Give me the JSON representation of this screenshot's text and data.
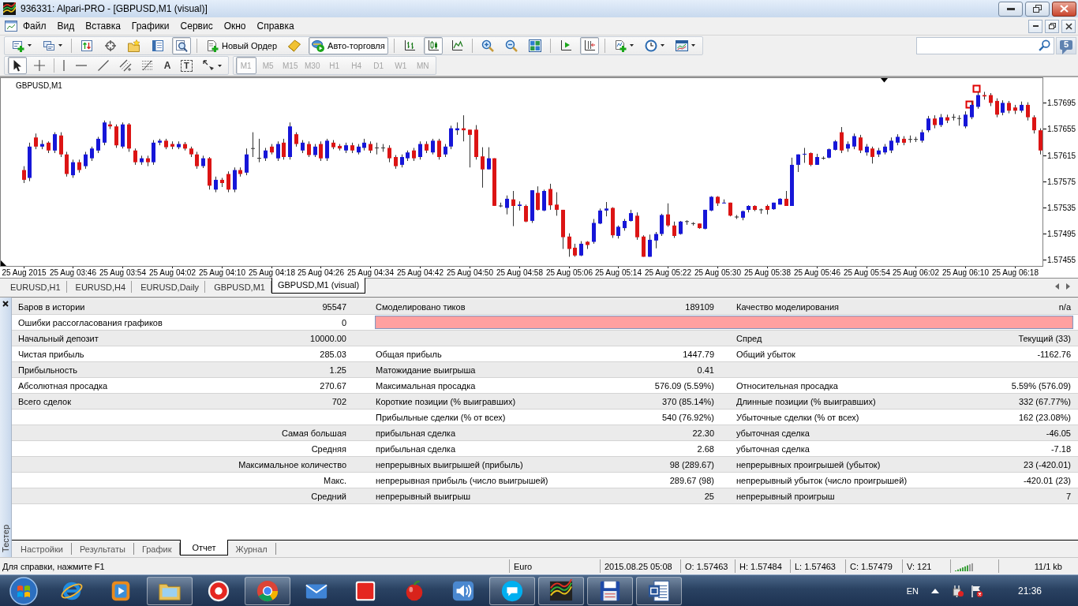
{
  "window": {
    "title": "936331: Alpari-PRO - [GBPUSD,M1 (visual)]"
  },
  "menu": [
    "Файл",
    "Вид",
    "Вставка",
    "Графики",
    "Сервис",
    "Окно",
    "Справка"
  ],
  "main_toolbar": [
    {
      "kind": "icon",
      "pressed": false
    },
    {
      "kind": "icon",
      "pressed": false
    },
    {
      "kind": "icon",
      "pressed": false
    },
    {
      "kind": "icon",
      "pressed": false
    },
    {
      "kind": "icon",
      "pressed": false
    },
    {
      "kind": "icon",
      "pressed": false
    },
    {
      "kind": "icon",
      "pressed": true
    },
    {
      "kind": "button",
      "label": "Новый Ордер",
      "pressed": false
    },
    {
      "kind": "icon",
      "pressed": false
    },
    {
      "kind": "button",
      "label": "Авто-торговля",
      "pressed": true
    },
    {
      "kind": "icon",
      "pressed": false
    },
    {
      "kind": "icon",
      "pressed": true
    },
    {
      "kind": "icon",
      "pressed": false
    },
    {
      "kind": "icon",
      "pressed": false
    },
    {
      "kind": "icon",
      "pressed": false
    },
    {
      "kind": "icon",
      "pressed": false
    },
    {
      "kind": "icon",
      "pressed": false
    },
    {
      "kind": "icon",
      "pressed": true
    },
    {
      "kind": "icon",
      "pressed": false
    },
    {
      "kind": "icon",
      "pressed": false
    },
    {
      "kind": "icon",
      "pressed": false
    }
  ],
  "notifications": {
    "count": "5"
  },
  "drawing_toolbar": [
    {
      "kind": "icon",
      "pressed": true
    },
    {
      "kind": "icon",
      "pressed": false
    },
    {
      "kind": "icon",
      "pressed": false
    },
    {
      "kind": "icon",
      "pressed": false
    },
    {
      "kind": "icon",
      "pressed": false
    },
    {
      "kind": "icon",
      "pressed": false
    },
    {
      "kind": "icon",
      "pressed": false
    },
    {
      "kind": "letter",
      "glyph": "A",
      "pressed": false
    },
    {
      "kind": "boxed_letter",
      "glyph": "T",
      "pressed": false
    },
    {
      "kind": "icon",
      "pressed": false
    }
  ],
  "periods": [
    {
      "label": "M1",
      "selected": true,
      "disabled": true
    },
    {
      "label": "M5",
      "selected": false,
      "disabled": true
    },
    {
      "label": "M15",
      "selected": false,
      "disabled": true
    },
    {
      "label": "M30",
      "selected": false,
      "disabled": true
    },
    {
      "label": "H1",
      "selected": false,
      "disabled": true
    },
    {
      "label": "H4",
      "selected": false,
      "disabled": true
    },
    {
      "label": "D1",
      "selected": false,
      "disabled": true
    },
    {
      "label": "W1",
      "selected": false,
      "disabled": true
    },
    {
      "label": "MN",
      "selected": false,
      "disabled": true
    }
  ],
  "chart": {
    "chart_data": [
      {
        "type": "candlestick",
        "title": "GBPUSD,M1",
        "ylim": [
          1.57445,
          1.57733
        ],
        "yticks": [
          1.57455,
          1.57495,
          1.57535,
          1.57575,
          1.57615,
          1.57655,
          1.57695
        ],
        "categories": [
          "25 Aug 2015",
          null,
          null,
          null,
          null,
          null,
          null,
          null,
          "25 Aug 03:46",
          null,
          null,
          null,
          null,
          null,
          null,
          null,
          "25 Aug 03:54",
          null,
          null,
          null,
          null,
          null,
          null,
          null,
          "25 Aug 04:02",
          null,
          null,
          null,
          null,
          null,
          null,
          null,
          "25 Aug 04:10",
          null,
          null,
          null,
          null,
          null,
          null,
          null,
          "25 Aug 04:18",
          null,
          null,
          null,
          null,
          null,
          null,
          null,
          "25 Aug 04:26",
          null,
          null,
          null,
          null,
          null,
          null,
          null,
          "25 Aug 04:34",
          null,
          null,
          null,
          null,
          null,
          null,
          null,
          "25 Aug 04:42",
          null,
          null,
          null,
          null,
          null,
          null,
          null,
          "25 Aug 04:50",
          null,
          null,
          null,
          null,
          null,
          null,
          null,
          "25 Aug 04:58",
          null,
          null,
          null,
          null,
          null,
          null,
          null,
          "25 Aug 05:06",
          null,
          null,
          null,
          null,
          null,
          null,
          null,
          "25 Aug 05:14",
          null,
          null,
          null,
          null,
          null,
          null,
          null,
          "25 Aug 05:22",
          null,
          null,
          null,
          null,
          null,
          null,
          null,
          "25 Aug 05:30",
          null,
          null,
          null,
          null,
          null,
          null,
          null,
          "25 Aug 05:38",
          null,
          null,
          null,
          null,
          null,
          null,
          null,
          "25 Aug 05:46",
          null,
          null,
          null,
          null,
          null,
          null,
          null,
          "25 Aug 05:54",
          null,
          null,
          null,
          null,
          null,
          null,
          null,
          "25 Aug 06:02",
          null,
          null,
          null,
          null,
          null,
          null,
          null,
          "25 Aug 06:10",
          null,
          null,
          null,
          null,
          null,
          null,
          null,
          "25 Aug 06:18",
          null,
          null,
          null,
          null
        ],
        "ohlc": [
          [
            1.57592,
            1.57598,
            1.57572,
            1.57577
          ],
          [
            1.5758,
            1.57634,
            1.57575,
            1.57628
          ],
          [
            1.57642,
            1.57648,
            1.57624,
            1.57628
          ],
          [
            1.57628,
            1.57638,
            1.57624,
            1.57632
          ],
          [
            1.57634,
            1.57636,
            1.57618,
            1.57622
          ],
          [
            1.57622,
            1.5765,
            1.57618,
            1.57647
          ],
          [
            1.57645,
            1.5765,
            1.57612,
            1.57616
          ],
          [
            1.57616,
            1.5762,
            1.57582,
            1.57586
          ],
          [
            1.57584,
            1.57608,
            1.5758,
            1.57604
          ],
          [
            1.57604,
            1.57608,
            1.57588,
            1.57592
          ],
          [
            1.57598,
            1.5762,
            1.57594,
            1.57616
          ],
          [
            1.5761,
            1.57628,
            1.57606,
            1.57625
          ],
          [
            1.57622,
            1.57643,
            1.57618,
            1.5764
          ],
          [
            1.57634,
            1.57668,
            1.5763,
            1.57665
          ],
          [
            1.57662,
            1.57667,
            1.57655,
            1.57659
          ],
          [
            1.57659,
            1.57662,
            1.57626,
            1.5763
          ],
          [
            1.57628,
            1.57665,
            1.57625,
            1.57662
          ],
          [
            1.57662,
            1.57664,
            1.5762,
            1.57625
          ],
          [
            1.57622,
            1.57625,
            1.576,
            1.57604
          ],
          [
            1.57604,
            1.57614,
            1.576,
            1.5761
          ],
          [
            1.5761,
            1.57614,
            1.57598,
            1.57604
          ],
          [
            1.57604,
            1.57638,
            1.576,
            1.57634
          ],
          [
            1.57634,
            1.5764,
            1.5763,
            1.57637
          ],
          [
            1.57637,
            1.5764,
            1.57624,
            1.57627
          ],
          [
            1.57632,
            1.57636,
            1.57624,
            1.57628
          ],
          [
            1.57627,
            1.57636,
            1.57624,
            1.57632
          ],
          [
            1.57632,
            1.57635,
            1.57622,
            1.57625
          ],
          [
            1.57625,
            1.57628,
            1.57612,
            1.57616
          ],
          [
            1.57616,
            1.5762,
            1.57594,
            1.57598
          ],
          [
            1.57598,
            1.57614,
            1.57595,
            1.5761
          ],
          [
            1.5761,
            1.57612,
            1.57562,
            1.57568
          ],
          [
            1.57562,
            1.57582,
            1.57558,
            1.57577
          ],
          [
            1.57577,
            1.5758,
            1.57566,
            1.57572
          ],
          [
            1.57586,
            1.5759,
            1.57558,
            1.57562
          ],
          [
            1.57562,
            1.57596,
            1.57558,
            1.57592
          ],
          [
            1.57592,
            1.57596,
            1.57582,
            1.57586
          ],
          [
            1.57588,
            1.57625,
            1.57584,
            1.57616
          ],
          [
            1.57625,
            1.5765,
            1.57612,
            1.57625
          ],
          [
            1.5761,
            1.5764,
            1.57604,
            1.5761
          ],
          [
            1.5761,
            1.57626,
            1.57606,
            1.57622
          ],
          [
            1.57628,
            1.57632,
            1.57616,
            1.57619
          ],
          [
            1.5761,
            1.57636,
            1.57606,
            1.57632
          ],
          [
            1.57634,
            1.5764,
            1.57608,
            1.57612
          ],
          [
            1.57612,
            1.57665,
            1.57608,
            1.57659
          ],
          [
            1.57647,
            1.5765,
            1.57628,
            1.57632
          ],
          [
            1.57622,
            1.57638,
            1.57618,
            1.57634
          ],
          [
            1.57632,
            1.57636,
            1.57612,
            1.57615
          ],
          [
            1.57615,
            1.57632,
            1.57612,
            1.57628
          ],
          [
            1.57632,
            1.57636,
            1.57606,
            1.5761
          ],
          [
            1.5761,
            1.5764,
            1.57606,
            1.57637
          ],
          [
            1.57634,
            1.57638,
            1.57624,
            1.57627
          ],
          [
            1.57629,
            1.57632,
            1.57622,
            1.57625
          ],
          [
            1.57622,
            1.57634,
            1.57618,
            1.5763
          ],
          [
            1.5763,
            1.57634,
            1.57618,
            1.57622
          ],
          [
            1.57619,
            1.57632,
            1.57616,
            1.57628
          ],
          [
            1.57626,
            1.5764,
            1.57622,
            1.57634
          ],
          [
            1.57632,
            1.57636,
            1.57618,
            1.57622
          ],
          [
            1.57626,
            1.57634,
            1.57616,
            1.57626
          ],
          [
            1.57626,
            1.57632,
            1.5762,
            1.57626
          ],
          [
            1.57626,
            1.5763,
            1.57604,
            1.5761
          ],
          [
            1.57612,
            1.57615,
            1.57594,
            1.57598
          ],
          [
            1.576,
            1.57616,
            1.57596,
            1.57612
          ],
          [
            1.5761,
            1.57622,
            1.57606,
            1.57619
          ],
          [
            1.57622,
            1.57626,
            1.57606,
            1.5761
          ],
          [
            1.57612,
            1.57636,
            1.57608,
            1.57632
          ],
          [
            1.57632,
            1.57636,
            1.57618,
            1.57622
          ],
          [
            1.57619,
            1.5764,
            1.57616,
            1.57637
          ],
          [
            1.57637,
            1.5764,
            1.57608,
            1.57612
          ],
          [
            1.57616,
            1.57632,
            1.57612,
            1.57628
          ],
          [
            1.57628,
            1.5766,
            1.57624,
            1.57656
          ],
          [
            1.57653,
            1.57665,
            1.57646,
            1.57656
          ],
          [
            1.57656,
            1.57676,
            1.57636,
            1.57653
          ],
          [
            1.57654,
            1.57654,
            1.57596,
            1.57646
          ],
          [
            1.57654,
            1.57661,
            1.57608,
            1.57612
          ],
          [
            1.57613,
            1.57627,
            1.57565,
            1.57593
          ],
          [
            1.57593,
            1.57627,
            1.57593,
            1.5761
          ],
          [
            1.5761,
            1.5761,
            1.57537,
            1.57537
          ],
          [
            1.57537,
            1.57542,
            1.57535,
            1.57537
          ],
          [
            1.57534,
            1.57553,
            1.57524,
            1.57548
          ],
          [
            1.57547,
            1.5756,
            1.57506,
            1.57537
          ],
          [
            1.57537,
            1.57544,
            1.5753,
            1.57539
          ],
          [
            1.57537,
            1.57539,
            1.57512,
            1.57513
          ],
          [
            1.57514,
            1.57561,
            1.57511,
            1.57561
          ],
          [
            1.57557,
            1.57567,
            1.5753,
            1.57531
          ],
          [
            1.5753,
            1.57562,
            1.57529,
            1.5756
          ],
          [
            1.57563,
            1.57571,
            1.57531,
            1.57538
          ],
          [
            1.57539,
            1.57558,
            1.57522,
            1.57531
          ],
          [
            1.57531,
            1.57531,
            1.57471,
            1.57489
          ],
          [
            1.5749,
            1.57495,
            1.57459,
            1.57471
          ],
          [
            1.57473,
            1.57479,
            1.57459,
            1.57461
          ],
          [
            1.57461,
            1.57483,
            1.5746,
            1.57479
          ],
          [
            1.57482,
            1.57483,
            1.57471,
            1.57477
          ],
          [
            1.57482,
            1.57517,
            1.57479,
            1.57511
          ],
          [
            1.5751,
            1.57533,
            1.57509,
            1.5753
          ],
          [
            1.5753,
            1.57543,
            1.57521,
            1.57533
          ],
          [
            1.57534,
            1.57535,
            1.57488,
            1.57492
          ],
          [
            1.57491,
            1.57507,
            1.57487,
            1.57505
          ],
          [
            1.57503,
            1.57517,
            1.57499,
            1.57514
          ],
          [
            1.57514,
            1.57531,
            1.57513,
            1.57526
          ],
          [
            1.57522,
            1.57527,
            1.57485,
            1.57489
          ],
          [
            1.5749,
            1.57492,
            1.57459,
            1.57459
          ],
          [
            1.57459,
            1.57493,
            1.57459,
            1.57485
          ],
          [
            1.57484,
            1.57497,
            1.57472,
            1.57494
          ],
          [
            1.57494,
            1.57525,
            1.57491,
            1.57523
          ],
          [
            1.57524,
            1.57541,
            1.57505,
            1.57507
          ],
          [
            1.57507,
            1.57513,
            1.57488,
            1.57491
          ],
          [
            1.57494,
            1.57514,
            1.57493,
            1.57513
          ],
          [
            1.57513,
            1.57515,
            1.57508,
            1.57513
          ],
          [
            1.5751,
            1.57512,
            1.57507,
            1.5751
          ],
          [
            1.5751,
            1.5751,
            1.57502,
            1.57503
          ],
          [
            1.57502,
            1.57531,
            1.57501,
            1.57531
          ],
          [
            1.5753,
            1.57552,
            1.57529,
            1.57551
          ],
          [
            1.57551,
            1.57552,
            1.57537,
            1.57541
          ],
          [
            1.57541,
            1.57547,
            1.57541,
            1.57542
          ],
          [
            1.57542,
            1.57542,
            1.57521,
            1.57522
          ],
          [
            1.5752,
            1.57523,
            1.57517,
            1.5752
          ],
          [
            1.57519,
            1.5753,
            1.57515,
            1.57529
          ],
          [
            1.57531,
            1.57538,
            1.57527,
            1.57537
          ],
          [
            1.57537,
            1.57538,
            1.57529,
            1.57531
          ],
          [
            1.57531,
            1.57533,
            1.57525,
            1.57531
          ],
          [
            1.57537,
            1.57539,
            1.57524,
            1.57531
          ],
          [
            1.57532,
            1.57542,
            1.57531,
            1.57542
          ],
          [
            1.57539,
            1.57549,
            1.57539,
            1.57548
          ],
          [
            1.57548,
            1.5756,
            1.57537,
            1.57537
          ],
          [
            1.57537,
            1.57611,
            1.57537,
            1.576
          ],
          [
            1.576,
            1.57616,
            1.57589,
            1.57616
          ],
          [
            1.57616,
            1.57626,
            1.57603,
            1.57617
          ],
          [
            1.57618,
            1.57619,
            1.57598,
            1.576
          ],
          [
            1.576,
            1.57617,
            1.576,
            1.57612
          ],
          [
            1.5761,
            1.57613,
            1.57608,
            1.5761
          ],
          [
            1.57611,
            1.57625,
            1.5761,
            1.57624
          ],
          [
            1.57623,
            1.57638,
            1.57622,
            1.57636
          ],
          [
            1.5765,
            1.57658,
            1.57618,
            1.57622
          ],
          [
            1.57625,
            1.57636,
            1.5762,
            1.57632
          ],
          [
            1.57628,
            1.57648,
            1.57624,
            1.57644
          ],
          [
            1.57642,
            1.57646,
            1.57618,
            1.57622
          ],
          [
            1.57619,
            1.57632,
            1.57614,
            1.57628
          ],
          [
            1.57625,
            1.57628,
            1.57602,
            1.57612
          ],
          [
            1.57616,
            1.57626,
            1.57612,
            1.57622
          ],
          [
            1.57619,
            1.57632,
            1.57616,
            1.57628
          ],
          [
            1.57622,
            1.57642,
            1.57618,
            1.57637
          ],
          [
            1.57634,
            1.57647,
            1.5763,
            1.57643
          ],
          [
            1.5764,
            1.57644,
            1.5763,
            1.57634
          ],
          [
            1.57639,
            1.57645,
            1.57634,
            1.57639
          ],
          [
            1.57639,
            1.57643,
            1.57635,
            1.57639
          ],
          [
            1.57637,
            1.57654,
            1.57634,
            1.5765
          ],
          [
            1.57653,
            1.57675,
            1.5765,
            1.57671
          ],
          [
            1.57671,
            1.57676,
            1.57656,
            1.57661
          ],
          [
            1.57661,
            1.57678,
            1.57658,
            1.57673
          ],
          [
            1.57673,
            1.57677,
            1.57664,
            1.57668
          ],
          [
            1.57673,
            1.57678,
            1.57668,
            1.57673
          ],
          [
            1.57671,
            1.57676,
            1.5766,
            1.57671
          ],
          [
            1.57659,
            1.57682,
            1.57656,
            1.57677
          ],
          [
            1.57673,
            1.57698,
            1.5767,
            1.57692
          ],
          [
            1.57689,
            1.57712,
            1.57686,
            1.57707
          ],
          [
            1.57707,
            1.57712,
            1.577,
            1.57705
          ],
          [
            1.57707,
            1.5771,
            1.5769,
            1.57695
          ],
          [
            1.57698,
            1.57702,
            1.57673,
            1.57677
          ],
          [
            1.5768,
            1.57699,
            1.57676,
            1.57695
          ],
          [
            1.57695,
            1.57698,
            1.57679,
            1.57683
          ],
          [
            1.57688,
            1.57692,
            1.57678,
            1.57683
          ],
          [
            1.57683,
            1.57697,
            1.5768,
            1.57692
          ],
          [
            1.57692,
            1.57696,
            1.57668,
            1.57673
          ],
          [
            1.57673,
            1.57676,
            1.57648,
            1.57653
          ],
          [
            1.57653,
            1.57656,
            1.57616,
            1.57622
          ]
        ]
      }
    ]
  },
  "chart_tabs": [
    {
      "label": "EURUSD,H1",
      "selected": false
    },
    {
      "label": "EURUSD,H4",
      "selected": false
    },
    {
      "label": "EURUSD,Daily",
      "selected": false
    },
    {
      "label": "GBPUSD,M1",
      "selected": false
    },
    {
      "label": "GBPUSD,M1 (visual)",
      "selected": true
    }
  ],
  "tester": {
    "title": "Тестер",
    "report": [
      {
        "kind": "stats",
        "left": {
          "label": "Баров в истории",
          "value": "95547"
        },
        "middle": {
          "label": "Смоделировано тиков",
          "value": "189109"
        },
        "right": {
          "label": "Качество моделирования",
          "value": "n/a"
        }
      },
      {
        "kind": "quality",
        "left": {
          "label": "Ошибки рассогласования графиков",
          "value": "0"
        },
        "quality": {
          "level": 1
        }
      },
      {
        "kind": "stats",
        "left": {
          "label": "Начальный депозит",
          "value": "10000.00"
        },
        "right": {
          "label": "Спред",
          "value": "Текущий (33)"
        }
      },
      {
        "kind": "stats",
        "left": {
          "label": "Чистая прибыль",
          "value": "285.03"
        },
        "middle": {
          "label": "Общая прибыль",
          "value": "1447.79"
        },
        "right": {
          "label": "Общий убыток",
          "value": "-1162.76"
        }
      },
      {
        "kind": "stats",
        "left": {
          "label": "Прибыльность",
          "value": "1.25"
        },
        "middle": {
          "label": "Матожидание выигрыша",
          "value": "0.41"
        }
      },
      {
        "kind": "stats",
        "left": {
          "label": "Абсолютная просадка",
          "value": "270.67"
        },
        "middle": {
          "label": "Максимальная просадка",
          "value": "576.09 (5.59%)"
        },
        "right": {
          "label": "Относительная просадка",
          "value": "5.59% (576.09)"
        }
      },
      {
        "kind": "stats",
        "left": {
          "label": "Всего сделок",
          "value": "702"
        },
        "middle": {
          "label": "Короткие позиции (% выигравших)",
          "value": "370 (85.14%)"
        },
        "right": {
          "label": "Длинные позиции (% выигравших)",
          "value": "332 (67.77%)"
        }
      },
      {
        "kind": "stats",
        "middle": {
          "label": "Прибыльные сделки (% от всех)",
          "value": "540 (76.92%)"
        },
        "right": {
          "label": "Убыточные сделки (% от всех)",
          "value": "162 (23.08%)"
        }
      },
      {
        "kind": "stats",
        "left": {
          "caption": "Самая большая"
        },
        "middle": {
          "label": "прибыльная сделка",
          "value": "22.30"
        },
        "right": {
          "label": "убыточная сделка",
          "value": "-46.05"
        }
      },
      {
        "kind": "stats",
        "left": {
          "caption": "Средняя"
        },
        "middle": {
          "label": "прибыльная сделка",
          "value": "2.68"
        },
        "right": {
          "label": "убыточная сделка",
          "value": "-7.18"
        }
      },
      {
        "kind": "stats",
        "left": {
          "caption": "Максимальное количество"
        },
        "middle": {
          "label": "непрерывных выигрышей (прибыль)",
          "value": "98 (289.67)"
        },
        "right": {
          "label": "непрерывных проигрышей (убыток)",
          "value": "23 (-420.01)"
        }
      },
      {
        "kind": "stats",
        "left": {
          "caption": "Макс."
        },
        "middle": {
          "label": "непрерывная прибыль (число выигрышей)",
          "value": "289.67 (98)"
        },
        "right": {
          "label": "непрерывный убыток (число проигрышей)",
          "value": "-420.01 (23)"
        }
      },
      {
        "kind": "stats",
        "left": {
          "caption": "Средний"
        },
        "middle": {
          "label": "непрерывный выигрыш",
          "value": "25"
        },
        "right": {
          "label": "непрерывный проигрыш",
          "value": "7"
        }
      }
    ],
    "tabs": [
      {
        "label": "Настройки",
        "selected": false
      },
      {
        "label": "Результаты",
        "selected": false
      },
      {
        "label": "График",
        "selected": false
      },
      {
        "label": "Отчет",
        "selected": true
      },
      {
        "label": "Журнал",
        "selected": false
      }
    ]
  },
  "status_bar": {
    "help": "Для справки, нажмите F1",
    "profile": "Euro",
    "time": "2015.08.25 05:08",
    "open": "O: 1.57463",
    "high": "H: 1.57484",
    "low": "L: 1.57463",
    "close": "C: 1.57479",
    "volume": "V: 121",
    "traffic": "11/1 kb"
  },
  "taskbar": {
    "apps": [
      {
        "running": false
      },
      {
        "running": false
      },
      {
        "running": true
      },
      {
        "running": false
      },
      {
        "running": true
      },
      {
        "running": false
      },
      {
        "running": false
      },
      {
        "running": false
      },
      {
        "running": false
      },
      {
        "running": true
      },
      {
        "running": true
      },
      {
        "running": true
      },
      {
        "running": true
      }
    ],
    "language": "EN",
    "clock": "21:36"
  }
}
